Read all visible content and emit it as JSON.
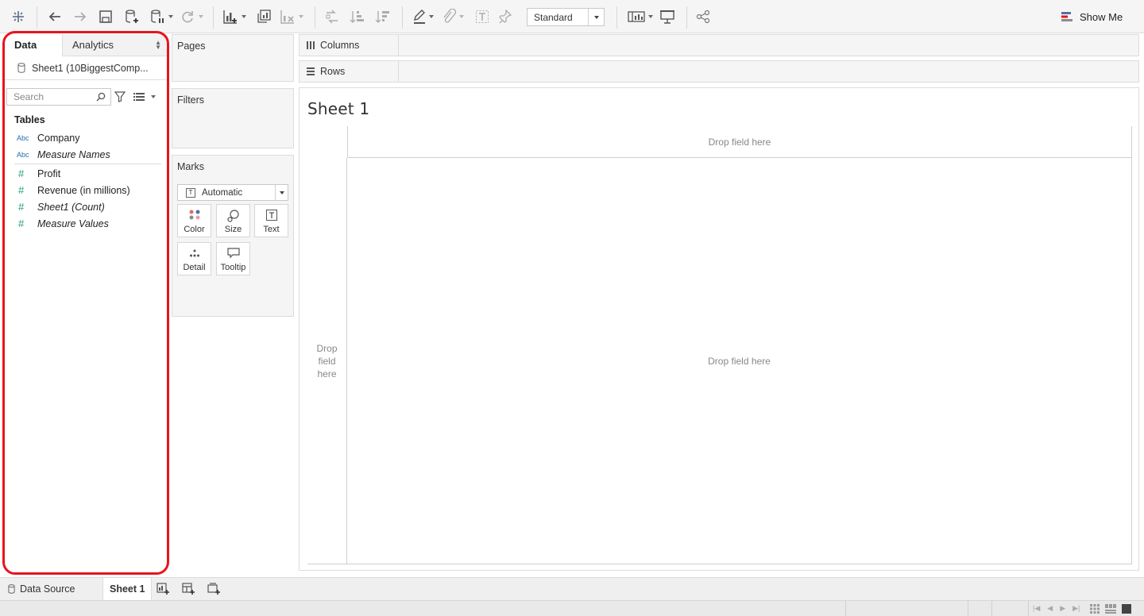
{
  "toolbar": {
    "view_select": "Standard",
    "show_me_label": "Show Me"
  },
  "data_pane": {
    "tab_data": "Data",
    "tab_analytics": "Analytics",
    "datasource": "Sheet1 (10BiggestComp...",
    "search_placeholder": "Search",
    "tables_heading": "Tables",
    "dimensions": [
      {
        "type": "Abc",
        "name": "Company",
        "italic": false
      },
      {
        "type": "Abc",
        "name": "Measure Names",
        "italic": true
      }
    ],
    "measures": [
      {
        "type": "#",
        "name": "Profit",
        "italic": false
      },
      {
        "type": "#",
        "name": "Revenue (in millions)",
        "italic": false
      },
      {
        "type": "#",
        "name": "Sheet1 (Count)",
        "italic": true
      },
      {
        "type": "#",
        "name": "Measure Values",
        "italic": true
      }
    ]
  },
  "cards": {
    "pages": "Pages",
    "filters": "Filters",
    "marks": "Marks",
    "marks_type": "Automatic",
    "mark_buttons": {
      "color": "Color",
      "size": "Size",
      "text": "Text",
      "detail": "Detail",
      "tooltip": "Tooltip"
    }
  },
  "shelves": {
    "columns": "Columns",
    "rows": "Rows"
  },
  "canvas": {
    "title": "Sheet 1",
    "drop_top": "Drop field here",
    "drop_left": [
      "Drop",
      "field",
      "here"
    ],
    "drop_main": "Drop field here"
  },
  "bottom_tabs": {
    "data_source": "Data Source",
    "sheet": "Sheet 1"
  },
  "colors": {
    "highlight": "#e8141c",
    "dimension": "#1f6fb5",
    "measure": "#1ba07a"
  }
}
